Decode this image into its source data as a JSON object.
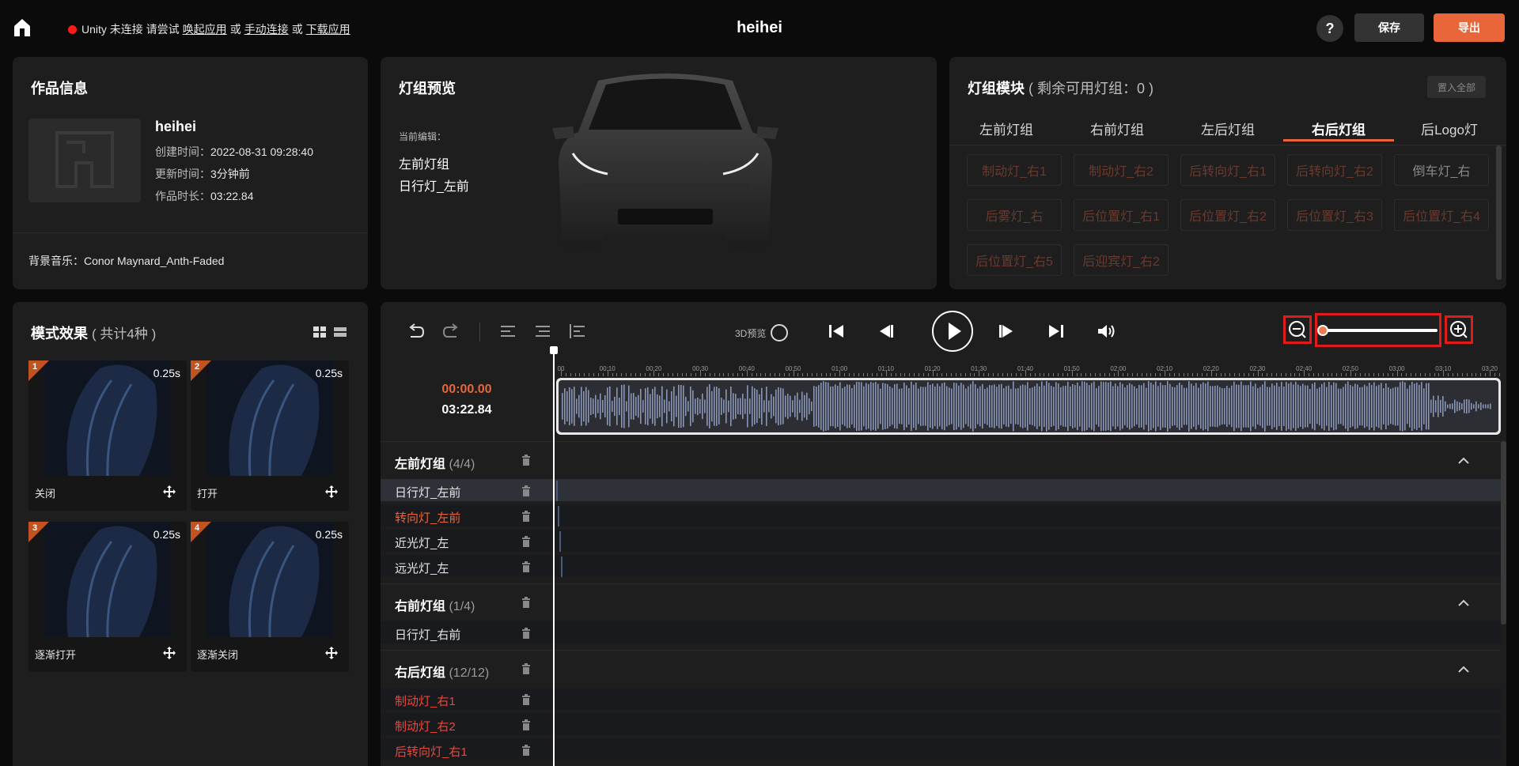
{
  "topbar": {
    "status_prefix": "Unity 未连接 请尝试",
    "link_wake": "唤起应用",
    "or1": "或",
    "link_manual": "手动连接",
    "or2": "或",
    "link_download": "下载应用",
    "title": "heihei",
    "help": "?",
    "save": "保存",
    "export": "导出"
  },
  "info": {
    "heading": "作品信息",
    "name": "heihei",
    "created_label": "创建时间：",
    "created": "2022-08-31 09:28:40",
    "updated_label": "更新时间：",
    "updated": "3分钟前",
    "duration_label": "作品时长：",
    "duration": "03:22.84",
    "music_label": "背景音乐：",
    "music": "Conor Maynard_Anth-Faded"
  },
  "preview": {
    "heading": "灯组预览",
    "current_label": "当前编辑：",
    "current_group": "左前灯组",
    "current_lamp": "日行灯_左前"
  },
  "module": {
    "heading": "灯组模块",
    "remaining": "( 剩余可用灯组：0 )",
    "put_all": "置入全部",
    "tabs": [
      "左前灯组",
      "右前灯组",
      "左后灯组",
      "右后灯组",
      "后Logo灯"
    ],
    "active_tab": 3,
    "chips": [
      "制动灯_右1",
      "制动灯_右2",
      "后转向灯_右1",
      "后转向灯_右2",
      "倒车灯_右",
      "后雾灯_右",
      "后位置灯_右1",
      "后位置灯_右2",
      "后位置灯_右3",
      "后位置灯_右4",
      "后位置灯_右5",
      "后迎宾灯_右2"
    ]
  },
  "effects": {
    "heading": "模式效果",
    "count": "( 共计4种 )",
    "cards": [
      {
        "num": "1",
        "dur": "0.25s",
        "name": "关闭"
      },
      {
        "num": "2",
        "dur": "0.25s",
        "name": "打开"
      },
      {
        "num": "3",
        "dur": "0.25s",
        "name": "逐渐打开"
      },
      {
        "num": "4",
        "dur": "0.25s",
        "name": "逐渐关闭"
      }
    ]
  },
  "timeline": {
    "preview3d": "3D预览",
    "current_time": "00:00.00",
    "total_time": "03:22.84",
    "zoom_level": 0.02,
    "ruler_labels": [
      "00",
      "00:10",
      "00:20",
      "00:30",
      "00:40",
      "00:50",
      "01:00",
      "01:10",
      "01:20",
      "01:30",
      "01:40",
      "01:50",
      "02:00",
      "02:10",
      "02:20",
      "02:30",
      "02:40",
      "02:50",
      "03:00",
      "03:10",
      "03:20"
    ],
    "groups": [
      {
        "name": "左前灯组",
        "count": "(4/4)",
        "lanes": [
          {
            "name": "日行灯_左前",
            "style": "sel"
          },
          {
            "name": "转向灯_左前",
            "style": "orange"
          },
          {
            "name": "近光灯_左",
            "style": ""
          },
          {
            "name": "远光灯_左",
            "style": ""
          }
        ]
      },
      {
        "name": "右前灯组",
        "count": "(1/4)",
        "lanes": [
          {
            "name": "日行灯_右前",
            "style": ""
          }
        ]
      },
      {
        "name": "右后灯组",
        "count": "(12/12)",
        "lanes": [
          {
            "name": "制动灯_右1",
            "style": "red"
          },
          {
            "name": "制动灯_右2",
            "style": "red"
          },
          {
            "name": "后转向灯_右1",
            "style": "red"
          }
        ]
      }
    ]
  },
  "colors": {
    "accent": "#e8663a",
    "panel": "#1e1e1e",
    "background": "#0b0b0b",
    "highlight_box": "#e01b1b"
  }
}
